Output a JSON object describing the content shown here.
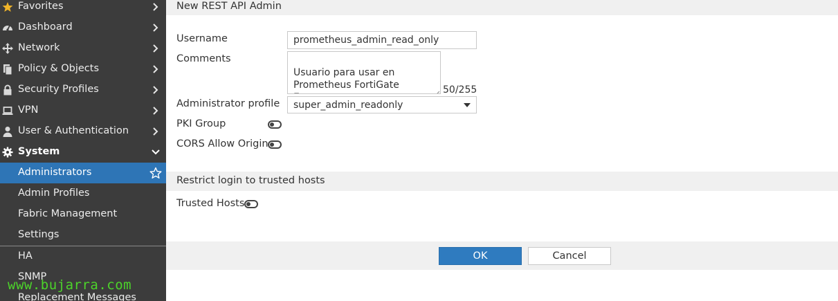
{
  "sidebar": {
    "items": [
      {
        "label": "Favorites",
        "icon": "star-icon"
      },
      {
        "label": "Dashboard",
        "icon": "dashboard-icon"
      },
      {
        "label": "Network",
        "icon": "network-icon"
      },
      {
        "label": "Policy & Objects",
        "icon": "policy-icon"
      },
      {
        "label": "Security Profiles",
        "icon": "lock-icon"
      },
      {
        "label": "VPN",
        "icon": "laptop-icon"
      },
      {
        "label": "User & Authentication",
        "icon": "user-icon"
      },
      {
        "label": "System",
        "icon": "gear-icon"
      }
    ],
    "system_subitems": [
      {
        "label": "Administrators",
        "active": true
      },
      {
        "label": "Admin Profiles"
      },
      {
        "label": "Fabric Management"
      },
      {
        "label": "Settings"
      },
      {
        "label": "HA"
      },
      {
        "label": "SNMP"
      },
      {
        "label": "Replacement Messages"
      }
    ],
    "active_color": "#2e75b6"
  },
  "watermark": "www.bujarra.com",
  "form": {
    "title": "New REST API Admin",
    "username_label": "Username",
    "username_value": "prometheus_admin_read_only",
    "comments_label": "Comments",
    "comments_value": "Usuario para usar en\nPrometheus FortiGate\nExporter",
    "comments_counter": "50/255",
    "admin_profile_label": "Administrator profile",
    "admin_profile_value": "super_admin_readonly",
    "pki_group_label": "PKI Group",
    "pki_group_enabled": false,
    "cors_label": "CORS Allow Origin",
    "cors_enabled": false
  },
  "trusted": {
    "section_title": "Restrict login to trusted hosts",
    "trusted_hosts_label": "Trusted Hosts",
    "trusted_hosts_enabled": false
  },
  "buttons": {
    "ok_label": "OK",
    "cancel_label": "Cancel",
    "primary_color": "#2f7bbf"
  }
}
